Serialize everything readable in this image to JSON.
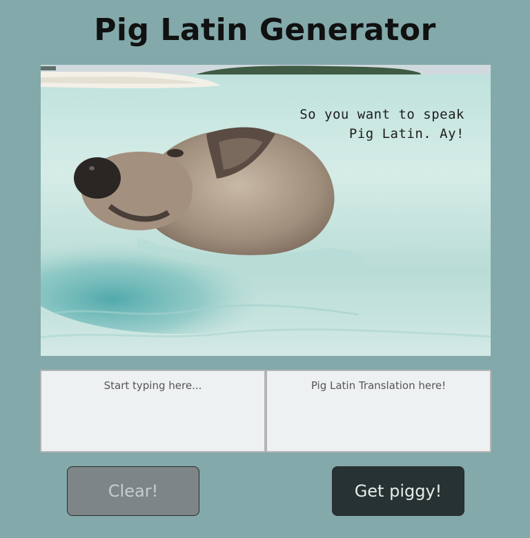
{
  "header": {
    "title": "Pig Latin Generator"
  },
  "hero": {
    "caption_line1": "So you want to speak",
    "caption_line2": "Pig Latin. Ay!"
  },
  "input": {
    "placeholder": "Start typing here...",
    "value": ""
  },
  "output": {
    "placeholder": "Pig Latin Translation here!",
    "value": ""
  },
  "buttons": {
    "clear_label": "Clear!",
    "translate_label": "Get piggy!"
  },
  "colors": {
    "background": "#83a9aa",
    "textbox_bg": "#edf1f2",
    "clear_button_bg": "#7d8587",
    "translate_button_bg": "#273232"
  }
}
